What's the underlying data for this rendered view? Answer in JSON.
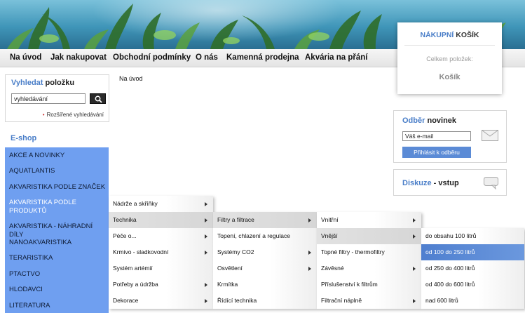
{
  "nav": {
    "items": [
      "Na úvod",
      "Jak nakupovat",
      "Obchodní podmínky",
      "O nás",
      "Kamenná prodejna",
      "Akvária na přání"
    ]
  },
  "cart": {
    "title_hl": "NÁKUPNÍ",
    "title_rest": "KOŠÍK",
    "count_label": "Celkem položek:",
    "link": "Košík"
  },
  "search": {
    "head_hl": "Vyhledat",
    "head_rest": "položku",
    "value": "vyhledávání",
    "advanced": "Rozšířené vyhledávání"
  },
  "eshop": {
    "title": "E-shop",
    "categories": [
      "AKCE A NOVINKY",
      "AQUATLANTIS",
      "AKVARISTIKA PODLE ZNAČEK",
      "AKVARISTIKA PODLE PRODUKTŮ",
      "AKVARISTIKA - NÁHRADNÍ DÍLY",
      "NANOAKVARISTIKA",
      "TERARISTIKA",
      "PTACTVO",
      "HLODAVCI",
      "LITERATURA"
    ]
  },
  "breadcrumb": "Na úvod",
  "newsletter": {
    "head_hl": "Odběr",
    "head_rest": "novinek",
    "email_value": "Váš e-mail",
    "button": "Přihlásit k odběru"
  },
  "discussion": {
    "head_hl": "Diskuze",
    "head_rest": "- vstup"
  },
  "menus": {
    "level1": [
      "Nádrže a skříňky",
      "Technika",
      "Péče o...",
      "Krmivo - sladkovodní",
      "Systém artémií",
      "Potřeby a údržba",
      "Dekorace"
    ],
    "level2": [
      "Filtry a filtrace",
      "Topení, chlazení a regulace",
      "Systémy CO2",
      "Osvětlení",
      "Krmítka",
      "Řídící technika"
    ],
    "level3": [
      "Vnitřní",
      "Vnější",
      "Topné filtry - thermofiltry",
      "Závěsné",
      "Příslušenství k filtrům",
      "Filtrační náplně"
    ],
    "level4": [
      "do obsahu 100 litrů",
      "od 100 do 250 litrů",
      "od 250 do 400 litrů",
      "od 400 do 600 litrů",
      "nad 600 litrů"
    ]
  },
  "colors": {
    "accent": "#4a7ec8",
    "sidebar": "#6f9ff0",
    "selected": "#5b8bd6"
  }
}
